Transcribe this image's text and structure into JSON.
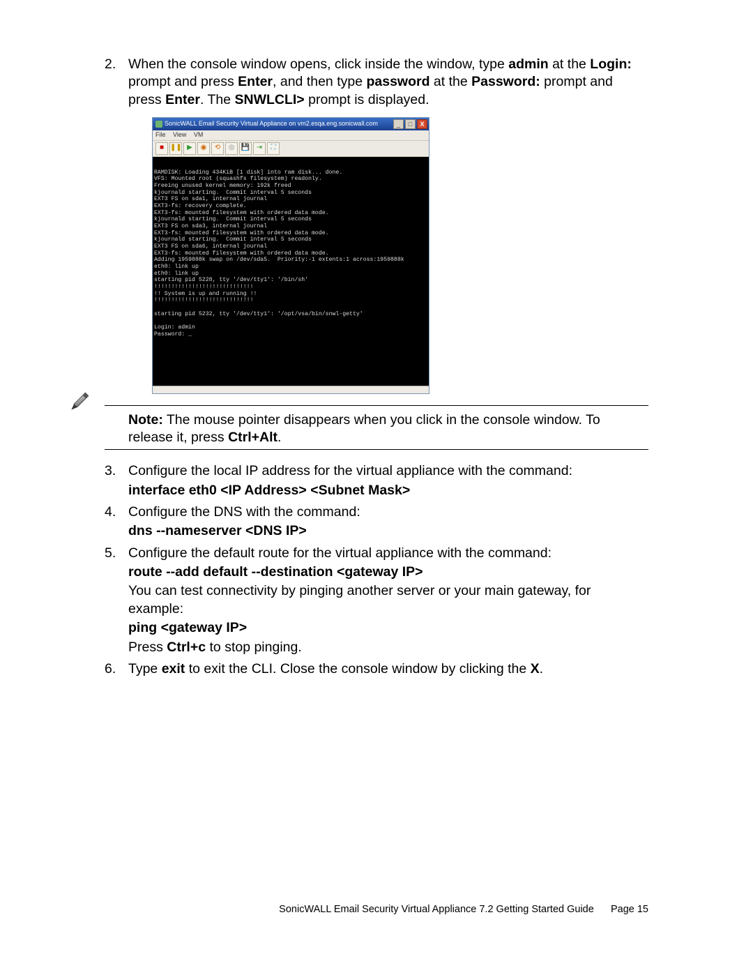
{
  "step2": {
    "p1a": "When the console window opens, click inside the window, type ",
    "p1b": "admin",
    "p1c": " at the ",
    "p1d": "Login:",
    "p1e": " prompt and press ",
    "p1f": "Enter",
    "p1g": ", and then type ",
    "p1h": "password",
    "p1i": " at the ",
    "p1j": "Password:",
    "p1k": " prompt and press ",
    "p1l": "Enter",
    "p1m": ". The ",
    "p1n": "SNWLCLI>",
    "p1o": " prompt is displayed."
  },
  "console": {
    "title": "SonicWALL Email Security Virtual Appliance on vm2.esqa.eng.sonicwall.com",
    "menu": {
      "file": "File",
      "view": "View",
      "vm": "VM"
    },
    "term": "RAMDISK: Loading 434KiB [1 disk] into ram disk... done.\nVFS: Mounted root (squashfs filesystem) readonly.\nFreeing unused kernel memory: 192k freed\nkjournald starting.  Commit interval 5 seconds\nEXT3 FS on sda1, internal journal\nEXT3-fs: recovery complete.\nEXT3-fs: mounted filesystem with ordered data mode.\nkjournald starting.  Commit interval 5 seconds\nEXT3 FS on sda3, internal journal\nEXT3-fs: mounted filesystem with ordered data mode.\nkjournald starting.  Commit interval 5 seconds\nEXT3 FS on sda6, internal journal\nEXT3-fs: mounted filesystem with ordered data mode.\nAdding 1959888k swap on /dev/sda5.  Priority:-1 extents:1 across:1959888k\neth0: link up\neth0: link up\nstarting pid 5228, tty '/dev/tty1': '/bin/sh'\n!!!!!!!!!!!!!!!!!!!!!!!!!!!!!\n!! System is up and running !!\n!!!!!!!!!!!!!!!!!!!!!!!!!!!!!\n\nstarting pid 5232, tty '/dev/tty1': '/opt/vsa/bin/snwl-getty'\n\nLogin: admin\nPassword: _"
  },
  "note": {
    "label": "Note:",
    "text1": "  The mouse pointer disappears when you click in the console window. To release it, press ",
    "text2": "Ctrl+Alt",
    "text3": "."
  },
  "step3": {
    "p": "Configure the local IP address for the virtual appliance with the command:",
    "cmd": "interface eth0 <IP Address> <Subnet Mask>"
  },
  "step4": {
    "p": "Configure the DNS with the command:",
    "cmd": "dns --nameserver <DNS IP>"
  },
  "step5": {
    "p": "Configure the default route for the virtual appliance with the command:",
    "cmd": "route --add default --destination <gateway IP>",
    "p2": "You can test connectivity by pinging another server or your main gateway, for example:",
    "cmd2": "ping <gateway IP>",
    "p3a": "Press ",
    "p3b": "Ctrl+c",
    "p3c": " to stop pinging."
  },
  "step6": {
    "a": "Type ",
    "b": "exit",
    "c": " to exit the CLI. Close the console window by clicking the ",
    "d": "X",
    "e": "."
  },
  "footer": {
    "title": "SonicWALL Email Security Virtual Appliance 7.2 Getting Started Guide",
    "page": "Page 15"
  }
}
